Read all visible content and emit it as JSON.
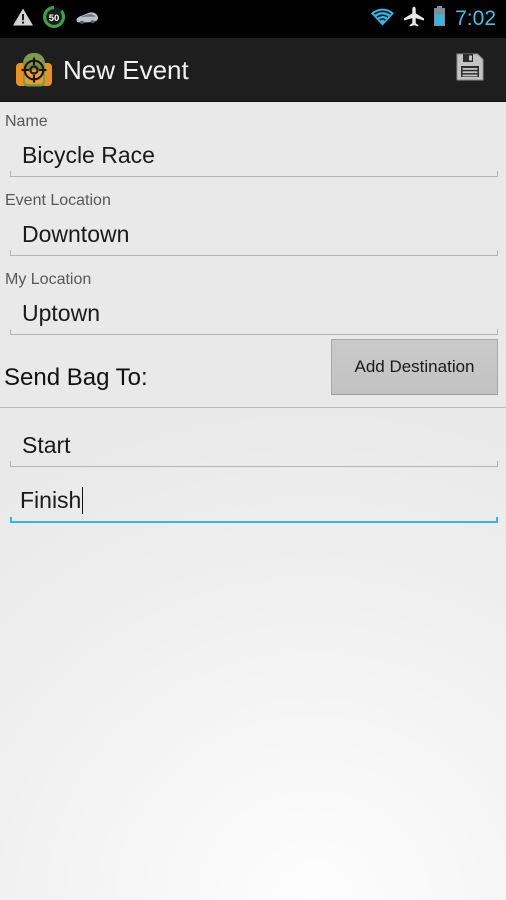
{
  "status_bar": {
    "left_icons": [
      {
        "name": "warning-triangle-icon",
        "label": "warning"
      },
      {
        "name": "speed-limit-icon",
        "label": "50"
      },
      {
        "name": "car-icon",
        "label": "vehicle"
      }
    ],
    "right_icons": [
      {
        "name": "wifi-icon",
        "label": "wifi"
      },
      {
        "name": "airplane-mode-icon",
        "label": "airplane mode"
      },
      {
        "name": "battery-icon",
        "label": "battery"
      }
    ],
    "speed_limit_value": "50",
    "clock": "7:02",
    "accent_color": "#33b5e5",
    "background_color": "#000000"
  },
  "action_bar": {
    "title": "New Event",
    "app_icon_name": "backpack-crosshair-icon",
    "save_icon_name": "save-floppy-icon",
    "save_label": "Save",
    "background_color": "#1e1e1e"
  },
  "form": {
    "fields": [
      {
        "label": "Name",
        "value": "Bicycle Race",
        "placeholder": "Name",
        "focused": false
      },
      {
        "label": "Event Location",
        "value": "Downtown",
        "placeholder": "Event Location",
        "focused": false
      },
      {
        "label": "My Location",
        "value": "Uptown",
        "placeholder": "My Location",
        "focused": false
      }
    ],
    "send_bag": {
      "label": "Send Bag To:",
      "add_button_label": "Add Destination"
    },
    "destinations": [
      {
        "value": "Start",
        "placeholder": "Destination",
        "focused": false
      },
      {
        "value": "Finish",
        "placeholder": "Destination",
        "focused": true
      }
    ]
  },
  "theme": {
    "focus_underline_color": "#33b5e5",
    "idle_underline_color": "#b4b4b4",
    "label_color": "#575757",
    "value_color": "#1a1a1a",
    "button_color": "#c6c6c6",
    "content_background": "#f1f1f1"
  }
}
